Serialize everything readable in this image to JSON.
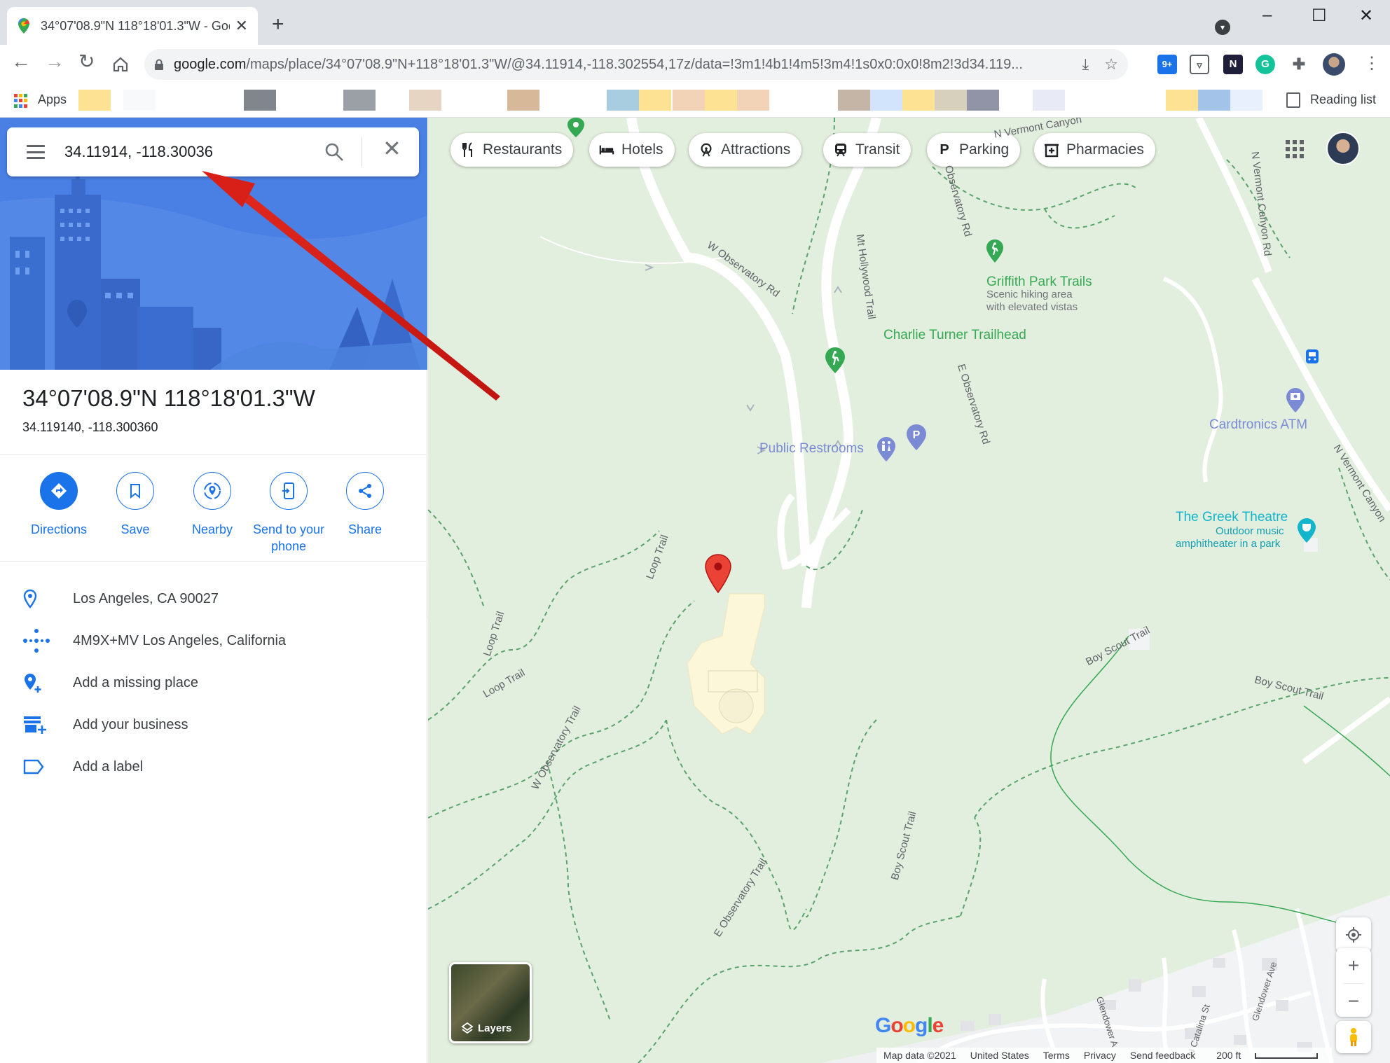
{
  "browser": {
    "tab_title": "34°07'08.9\"N 118°18'01.3\"W - Google Maps",
    "url_main": "google.com",
    "url_path": "/maps/place/34°07'08.9\"N+118°18'01.3\"W/@34.11914,-118.302554,17z/data=!3m1!4b1!4m5!3m4!1s0x0:0x0!8m2!3d34.119...",
    "ext_badge": "9+",
    "apps_label": "Apps",
    "reading_list_label": "Reading list",
    "bookmark_colors": [
      "#fde293",
      "#f8f9fa",
      "#80868b",
      "#9aa0a6",
      "#e6d5c3",
      "#d7b899",
      "#a8cde0",
      "#fde293",
      "#f2d3b8",
      "#fde293",
      "#f2d3b8",
      "#c5b5a6",
      "#d2e3fc",
      "#fde293",
      "#d7d0bd",
      "#9194a6",
      "#e8eaf6",
      "#fde293",
      "#a3c4e8",
      "#e8f0fe"
    ]
  },
  "search": {
    "query": "34.11914, -118.30036"
  },
  "place": {
    "title": "34°07'08.9\"N 118°18'01.3\"W",
    "decimal": "34.119140, -118.300360"
  },
  "actions": [
    {
      "label": "Directions",
      "icon": "directions-icon"
    },
    {
      "label": "Save",
      "icon": "bookmark-icon"
    },
    {
      "label": "Nearby",
      "icon": "nearby-icon"
    },
    {
      "label": "Send to your phone",
      "icon": "phone-icon"
    },
    {
      "label": "Share",
      "icon": "share-icon"
    }
  ],
  "info": [
    {
      "text": "Los Angeles, CA 90027",
      "icon": "location-pin-icon"
    },
    {
      "text": "4M9X+MV Los Angeles, California",
      "icon": "plus-code-icon"
    },
    {
      "text": "Add a missing place",
      "icon": "add-place-icon"
    },
    {
      "text": "Add your business",
      "icon": "add-business-icon"
    },
    {
      "text": "Add a label",
      "icon": "label-icon"
    }
  ],
  "chips": [
    {
      "label": "Restaurants",
      "icon": "fork-knife-icon"
    },
    {
      "label": "Hotels",
      "icon": "bed-icon"
    },
    {
      "label": "Attractions",
      "icon": "ferris-wheel-icon"
    },
    {
      "label": "Transit",
      "icon": "train-icon"
    },
    {
      "label": "Parking",
      "icon": "parking-icon"
    },
    {
      "label": "Pharmacies",
      "icon": "pharmacy-icon"
    }
  ],
  "map": {
    "pois": {
      "charlie": "Charlie Turner Trailhead",
      "restrooms": "Public Restrooms",
      "griffith": "Griffith Park Trails",
      "griffith_sub1": "Scenic hiking area",
      "griffith_sub2": "with elevated vistas",
      "atm": "Cardtronics ATM",
      "greek": "The Greek Theatre",
      "greek_sub1": "Outdoor music",
      "greek_sub2": "amphitheater in a park"
    },
    "roads": {
      "w_obs_rd": "W Observatory Rd",
      "mt_hollywood": "Mt Hollywood Trail",
      "e_obs_rd": "E Observatory Rd",
      "vermont_canyon_top": "N Vermont Canyon",
      "vermont_canyon": "N Vermont Canyon Rd",
      "vermont_canyon_2": "N Vermont Canyon",
      "observatory_rd_top": "Observatory Rd",
      "loop_trail_1": "Loop Trail",
      "loop_trail_2": "Loop Trail",
      "loop_trail_3": "Loop Trail",
      "w_obs_trail": "W Observatory Trail",
      "e_obs_trail": "E Observatory Trail",
      "boy_scout_1": "Boy Scout Trail",
      "boy_scout_2": "Boy Scout Trail",
      "boy_scout_3": "Boy Scout Trail",
      "glendower": "Glendower Ave",
      "catalina": "N Catalina St",
      "glendower_a": "Glendower A"
    },
    "layers_label": "Layers",
    "google_logo": "Google",
    "footer": {
      "map_data": "Map data ©2021",
      "country": "United States",
      "terms": "Terms",
      "privacy": "Privacy",
      "feedback": "Send feedback",
      "scale": "200 ft"
    }
  }
}
